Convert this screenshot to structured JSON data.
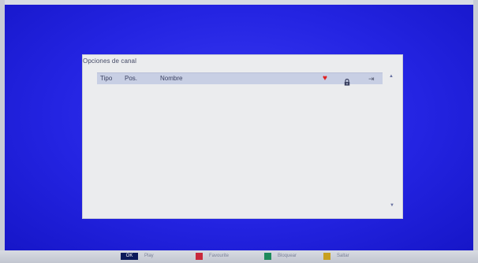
{
  "panel": {
    "title": "Opciones de canal",
    "columns": {
      "tipo": "Tipo",
      "pos": "Pos.",
      "nombre": "Nombre"
    },
    "column_icons": [
      "heart-icon",
      "lock-icon",
      "skip-icon"
    ],
    "channels": []
  },
  "footer": {
    "items": [
      {
        "key_label": "OK",
        "key_color": "#0c1a5a",
        "label": "Play"
      },
      {
        "key_label": "",
        "key_color": "#c8283c",
        "label": "Favourite"
      },
      {
        "key_label": "",
        "key_color": "#1e8a5c",
        "label": "Bloquear"
      },
      {
        "key_label": "",
        "key_color": "#c8a020",
        "label": "Saltar"
      }
    ]
  },
  "colors": {
    "screen_bg": "#2424e2",
    "panel_bg": "#ebecee",
    "header_bg": "#c8cfe4",
    "favourite": "#e02020"
  }
}
